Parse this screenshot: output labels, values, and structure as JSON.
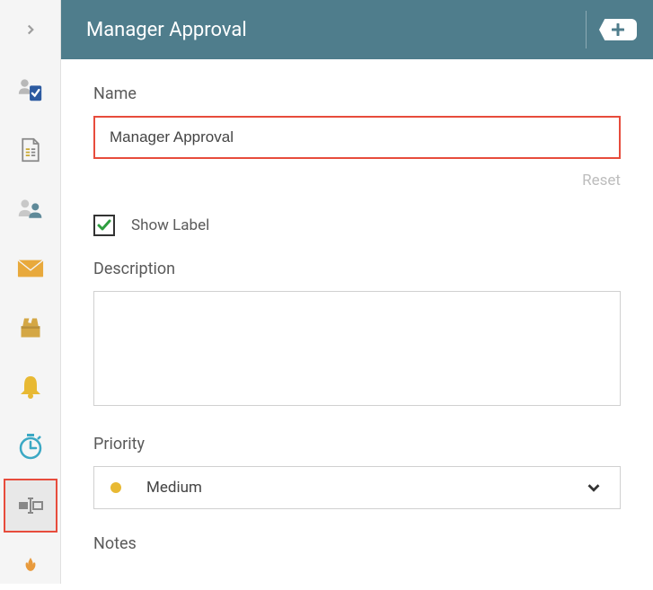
{
  "header": {
    "title": "Manager Approval"
  },
  "form": {
    "name_label": "Name",
    "name_value": "Manager Approval",
    "reset_label": "Reset",
    "show_label_text": "Show Label",
    "show_label_checked": true,
    "description_label": "Description",
    "description_value": "",
    "priority_label": "Priority",
    "priority_value": "Medium",
    "notes_label": "Notes"
  },
  "sidebar": {
    "items": [
      {
        "name": "approval-icon"
      },
      {
        "name": "document-icon"
      },
      {
        "name": "users-icon"
      },
      {
        "name": "mail-icon"
      },
      {
        "name": "ballot-icon"
      },
      {
        "name": "bell-icon"
      },
      {
        "name": "timer-icon"
      },
      {
        "name": "input-icon"
      },
      {
        "name": "flame-icon"
      }
    ]
  }
}
